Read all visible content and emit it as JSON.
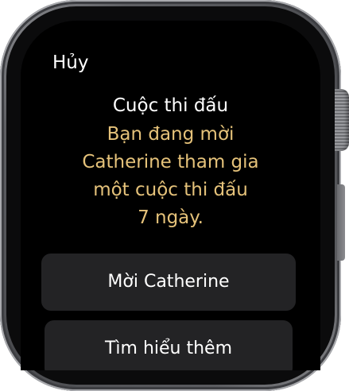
{
  "header": {
    "cancel_label": "Hủy"
  },
  "main": {
    "title": "Cuộc thi đấu",
    "message_lines": [
      "Bạn đang mời",
      "Catherine tham gia",
      "một cuộc thi đấu",
      "7 ngày."
    ]
  },
  "actions": {
    "invite_label": "Mời Catherine",
    "learn_more_label": "Tìm hiểu thêm"
  },
  "colors": {
    "background": "#000000",
    "primary_text": "#ffffff",
    "accent_text": "#e5c27a",
    "button_background": "#232325"
  }
}
